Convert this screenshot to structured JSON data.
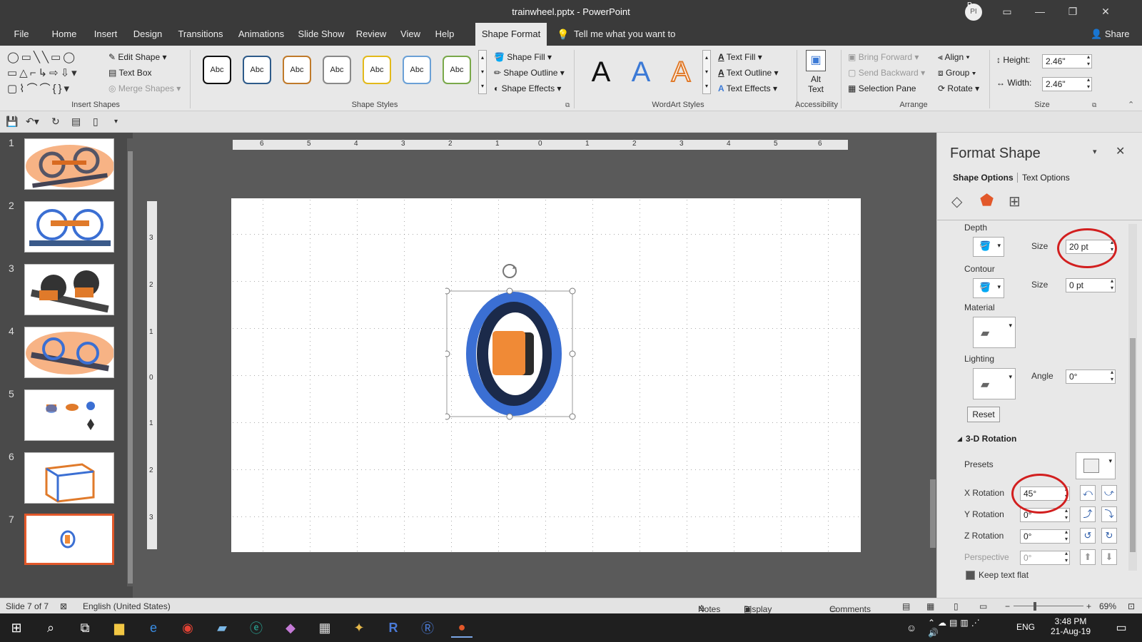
{
  "window": {
    "title": "trainwheel.pptx - PowerPoint",
    "user_initials": "PI",
    "user_badge": "P"
  },
  "menu": {
    "tabs": [
      "File",
      "Home",
      "Insert",
      "Design",
      "Transitions",
      "Animations",
      "Slide Show",
      "Review",
      "View",
      "Help",
      "Shape Format"
    ],
    "active": "Shape Format",
    "tell_me": "Tell me what you want to do",
    "share": "Share"
  },
  "ribbon": {
    "insert_shapes": {
      "label": "Insert Shapes",
      "edit_shape": "Edit Shape",
      "text_box": "Text Box",
      "merge_shapes": "Merge Shapes"
    },
    "shape_styles": {
      "label": "Shape Styles",
      "sample": "Abc",
      "shape_fill": "Shape Fill",
      "shape_outline": "Shape Outline",
      "shape_effects": "Shape Effects"
    },
    "wordart": {
      "label": "WordArt Styles",
      "sample": "A",
      "text_fill": "Text Fill",
      "text_outline": "Text Outline",
      "text_effects": "Text Effects"
    },
    "accessibility": {
      "label": "Accessibility",
      "alt_text_1": "Alt",
      "alt_text_2": "Text"
    },
    "arrange": {
      "label": "Arrange",
      "bring_forward": "Bring Forward",
      "send_backward": "Send Backward",
      "selection_pane": "Selection Pane",
      "align": "Align",
      "group": "Group",
      "rotate": "Rotate"
    },
    "size": {
      "label": "Size",
      "height_label": "Height:",
      "height": "2.46\"",
      "width_label": "Width:",
      "width": "2.46\""
    }
  },
  "thumbnails": [
    {
      "num": "1"
    },
    {
      "num": "2"
    },
    {
      "num": "3"
    },
    {
      "num": "4"
    },
    {
      "num": "5"
    },
    {
      "num": "6"
    },
    {
      "num": "7"
    }
  ],
  "ruler": {
    "h_ticks": [
      "6",
      "5",
      "4",
      "3",
      "2",
      "1",
      "0",
      "1",
      "2",
      "3",
      "4",
      "5",
      "6"
    ],
    "v_ticks": [
      "3",
      "2",
      "1",
      "0",
      "1",
      "2",
      "3"
    ]
  },
  "format_pane": {
    "title": "Format Shape",
    "tab_shape": "Shape Options",
    "tab_text": "Text Options",
    "depth": "Depth",
    "size_label": "Size",
    "depth_size": "20 pt",
    "contour": "Contour",
    "contour_size": "0 pt",
    "material": "Material",
    "lighting": "Lighting",
    "angle_label": "Angle",
    "angle": "0°",
    "reset": "Reset",
    "rotation_header": "3-D Rotation",
    "presets": "Presets",
    "x_rotation_label": "X Rotation",
    "x_rotation": "45°",
    "y_rotation_label": "Y Rotation",
    "y_rotation": "0°",
    "z_rotation_label": "Z Rotation",
    "z_rotation": "0°",
    "perspective_label": "Perspective",
    "perspective": "0°",
    "keep_flat": "Keep text flat"
  },
  "status": {
    "slide": "Slide 7 of 7",
    "language": "English (United States)",
    "notes": "Notes",
    "display": "Display Settings",
    "comments": "Comments",
    "zoom": "69%"
  },
  "taskbar": {
    "lang": "ENG",
    "time": "3:48 PM",
    "date": "21-Aug-19"
  },
  "colors": {
    "accent": "#b7472a",
    "ring_blue": "#3b6fd3",
    "shape_orange": "#f08a36",
    "highlight_red": "#d21f1f"
  }
}
